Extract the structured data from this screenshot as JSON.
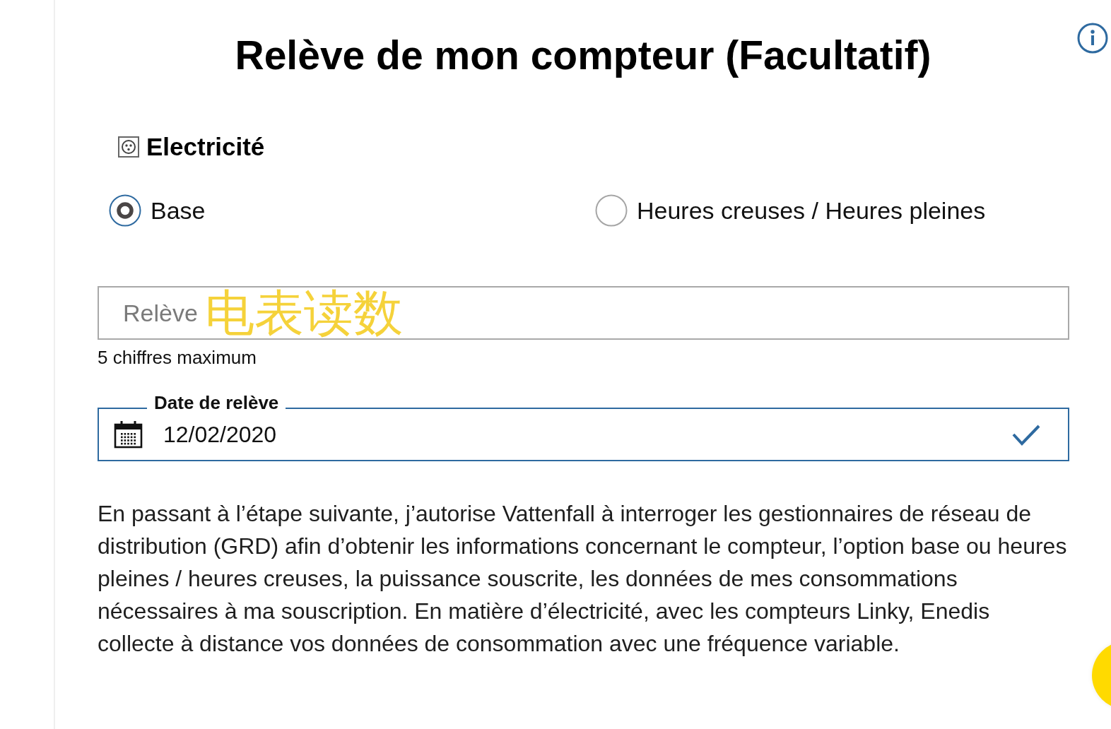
{
  "title": "Relève de mon compteur (Facultatif)",
  "energy": {
    "label": "Electricité"
  },
  "tariff_options": [
    {
      "label": "Base",
      "selected": true
    },
    {
      "label": "Heures creuses / Heures pleines",
      "selected": false
    }
  ],
  "meter_reading": {
    "placeholder": "Relève",
    "annotation": "电表读数",
    "hint": "5 chiffres maximum"
  },
  "reading_date": {
    "label": "Date de relève",
    "value": "12/02/2020",
    "valid": true
  },
  "consent_text": "En passant à l’étape suivante, j’autorise Vattenfall à interroger les gestionnaires de réseau de distribution (GRD) afin d’obtenir les informations concernant le compteur, l’option base ou heures pleines / heures creuses, la puissance souscrite, les données de mes consommations nécessaires à ma souscription. En matière d’électricité, avec les compteurs Linky, Enedis collecte à distance vos données de consommation avec une fréquence variable."
}
